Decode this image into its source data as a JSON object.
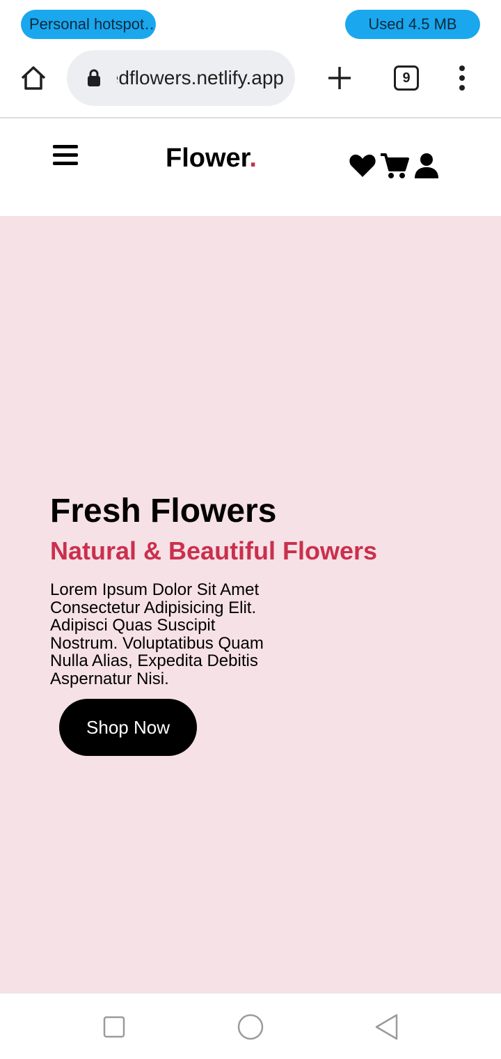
{
  "status_bar": {
    "hotspot_label": "Personal hotspot…",
    "data_usage_label": "Used  4.5 MB",
    "pill_color": "#1aa7ee"
  },
  "browser": {
    "url": "redflowers.netlify.app",
    "tab_count": "9",
    "icons": [
      "home-icon",
      "lock-icon",
      "plus-icon",
      "tabs-icon",
      "more-vert-icon"
    ]
  },
  "header": {
    "logo_text": "Flower",
    "logo_dot": ".",
    "icons": [
      "menu-icon",
      "heart-icon",
      "cart-icon",
      "user-icon"
    ]
  },
  "hero": {
    "title": "Fresh Flowers",
    "subtitle": "Natural & Beautiful Flowers",
    "description": "Lorem Ipsum Dolor Sit Amet Consectetur Adipisicing Elit. Adipisci Quas Suscipit Nostrum. Voluptatibus Quam Nulla Alias, Expedita Debitis Aspernatur Nisi.",
    "button_label": "Shop Now",
    "background_color": "#f6e1e6",
    "accent_color": "#c9304d"
  },
  "nav_bar": {
    "icons": [
      "recents-square-icon",
      "home-circle-icon",
      "back-triangle-icon"
    ]
  }
}
